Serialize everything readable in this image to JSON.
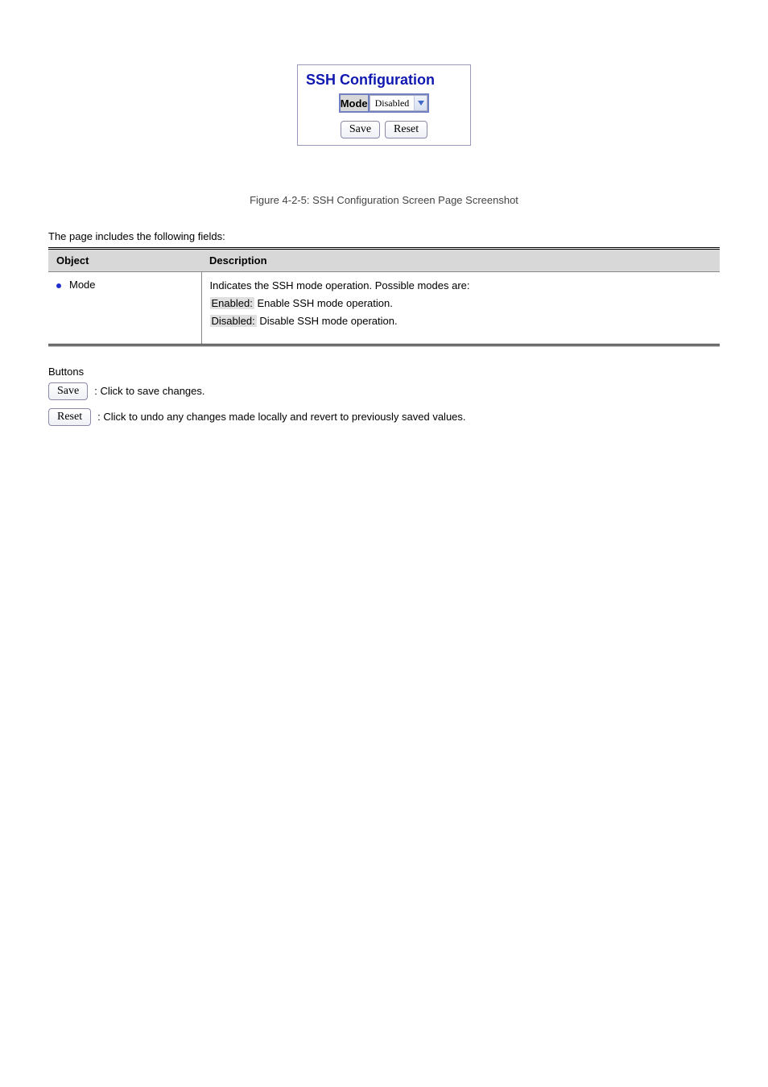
{
  "figure": {
    "title": "SSH Configuration",
    "mode_label": "Mode",
    "mode_value": "Disabled",
    "save_label": "Save",
    "reset_label": "Reset"
  },
  "caption": "Figure 4-2-5: SSH Configuration Screen Page Screenshot",
  "table": {
    "head_object": "Object",
    "head_desc": "Description",
    "row": {
      "object": "Mode",
      "line1": "Indicates the SSH mode operation. Possible modes are:",
      "enabled_label": "Enabled:",
      "enabled_text": " Enable SSH mode operation.",
      "disabled_label": "Disabled:",
      "disabled_text": " Disable SSH mode operation."
    }
  },
  "buttons": {
    "section": "Buttons",
    "save_btn": "Save",
    "save_desc": ": Click to save changes.",
    "reset_btn": "Reset",
    "reset_desc": ": Click to undo any changes made locally and revert to previously saved values."
  }
}
